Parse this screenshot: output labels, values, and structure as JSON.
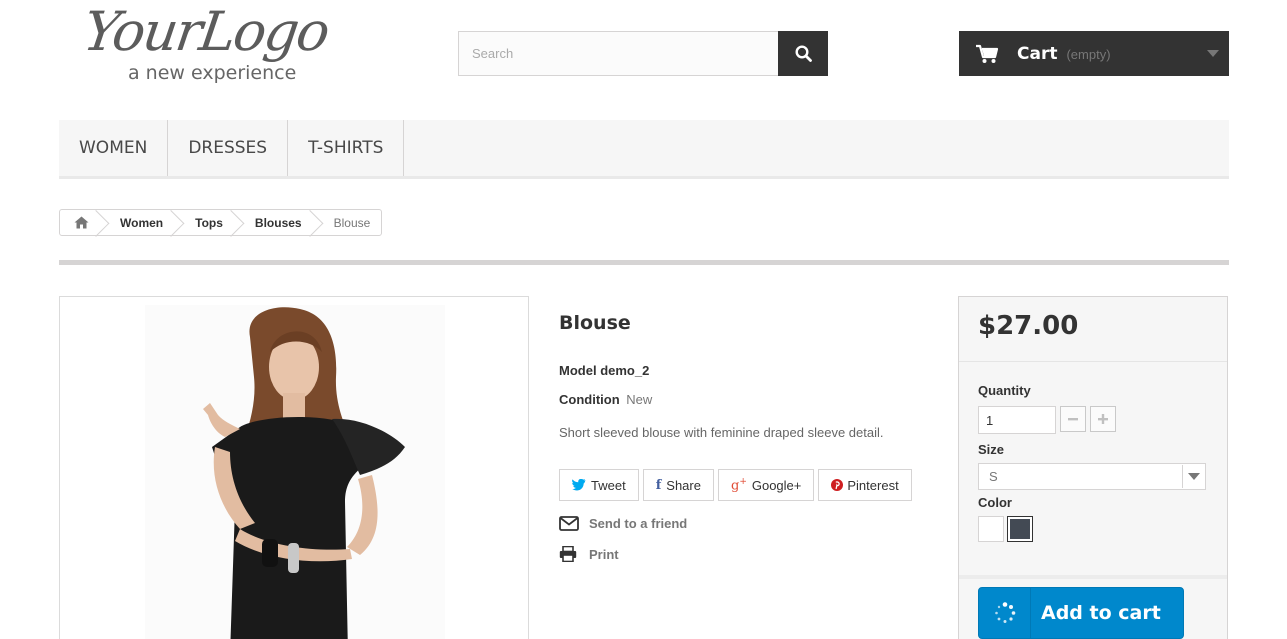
{
  "header": {
    "logo_script": "YourLogo",
    "logo_tagline": "a new experience",
    "search_placeholder": "Search",
    "cart_label": "Cart",
    "cart_status": "(empty)"
  },
  "menu": {
    "items": [
      "Women",
      "Dresses",
      "T-shirts"
    ]
  },
  "breadcrumb": {
    "items": [
      "Women",
      "Tops",
      "Blouses"
    ],
    "current": "Blouse"
  },
  "product": {
    "title": "Blouse",
    "model_label": "Model",
    "model_value": "demo_2",
    "condition_label": "Condition",
    "condition_value": "New",
    "description": "Short sleeved blouse with feminine draped sleeve detail.",
    "social": {
      "tweet": "Tweet",
      "share": "Share",
      "googleplus": "Google+",
      "pinterest": "Pinterest"
    },
    "send_to_friend": "Send to a friend",
    "print": "Print"
  },
  "buy_box": {
    "price": "$27.00",
    "quantity_label": "Quantity",
    "quantity_value": "1",
    "size_label": "Size",
    "size_value": "S",
    "color_label": "Color",
    "colors": [
      "#ffffff",
      "#434a54"
    ],
    "selected_color_index": 1,
    "add_to_cart_label": "Add to cart"
  },
  "icons": {
    "search": "search-icon",
    "cart": "cart-icon",
    "home": "home-icon",
    "envelope": "envelope-icon",
    "print": "printer-icon",
    "spinner": "spinner-icon"
  }
}
